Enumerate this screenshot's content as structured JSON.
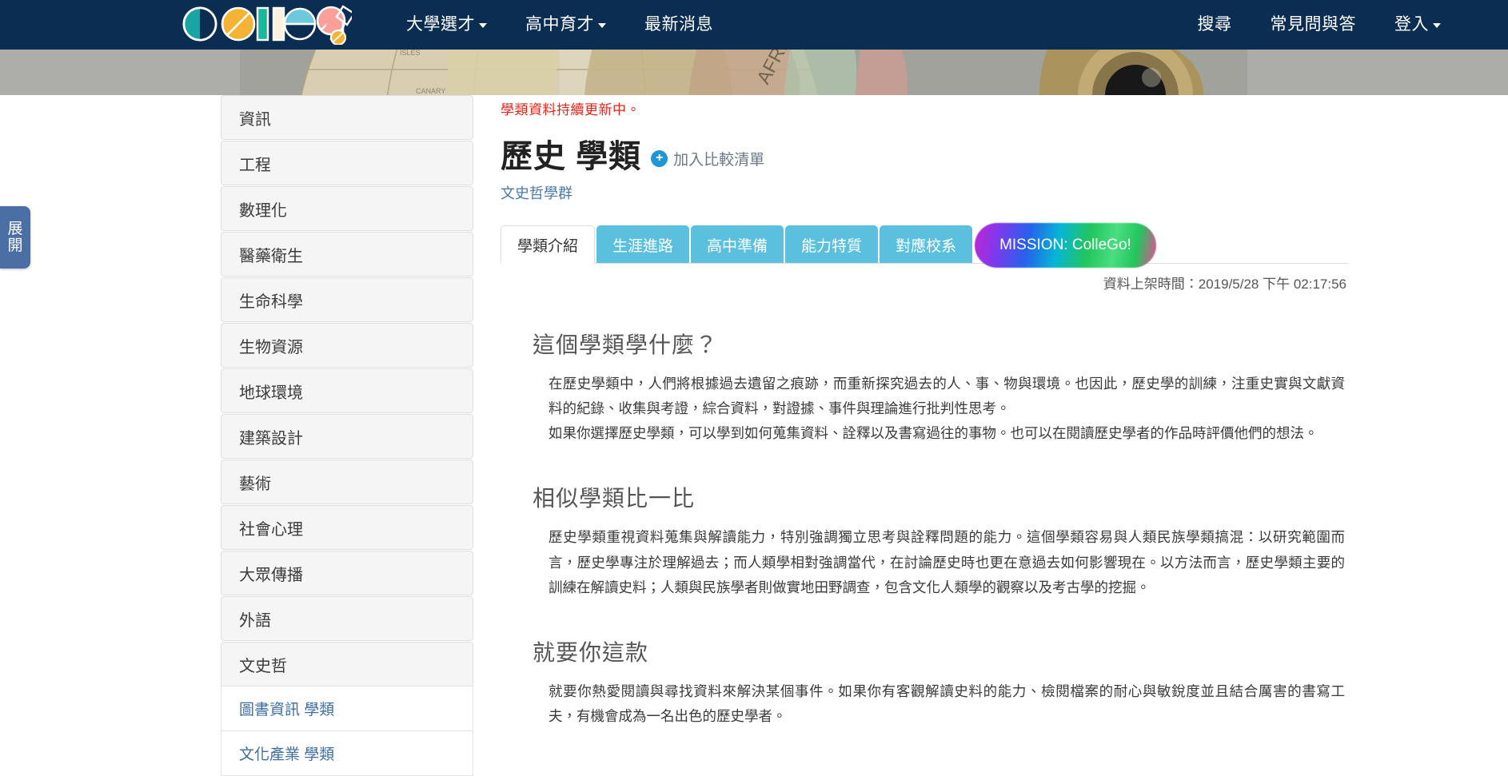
{
  "navbar": {
    "brand_text": "collego",
    "left_items": [
      {
        "label": "大學選才",
        "has_caret": true
      },
      {
        "label": "高中育才",
        "has_caret": true
      },
      {
        "label": "最新消息",
        "has_caret": false
      }
    ],
    "right_items": [
      {
        "label": "搜尋",
        "has_caret": false
      },
      {
        "label": "常見問與答",
        "has_caret": false
      },
      {
        "label": "登入",
        "has_caret": true
      }
    ],
    "background_color": "#0b2d52"
  },
  "expand_tab": {
    "label_line1": "展",
    "label_line2": "開",
    "color": "#4a6fa5"
  },
  "sidebar": {
    "items": [
      {
        "label": "資訊",
        "expanded": false
      },
      {
        "label": "工程",
        "expanded": false
      },
      {
        "label": "數理化",
        "expanded": false
      },
      {
        "label": "醫藥衛生",
        "expanded": false
      },
      {
        "label": "生命科學",
        "expanded": false
      },
      {
        "label": "生物資源",
        "expanded": false
      },
      {
        "label": "地球環境",
        "expanded": false
      },
      {
        "label": "建築設計",
        "expanded": false
      },
      {
        "label": "藝術",
        "expanded": false
      },
      {
        "label": "社會心理",
        "expanded": false
      },
      {
        "label": "大眾傳播",
        "expanded": false
      },
      {
        "label": "外語",
        "expanded": false
      },
      {
        "label": "文史哲",
        "expanded": true
      }
    ],
    "sub_items": [
      {
        "label": "圖書資訊 學類"
      },
      {
        "label": "文化產業 學類"
      }
    ]
  },
  "main": {
    "update_note": "學類資料持續更新中。",
    "title": "歷史 學類",
    "add_to_compare": "加入比較清單",
    "subtitle": "文史哲學群",
    "tabs": [
      {
        "label": "學類介紹",
        "active": true,
        "mission": false
      },
      {
        "label": "生涯進路",
        "active": false,
        "mission": false
      },
      {
        "label": "高中準備",
        "active": false,
        "mission": false
      },
      {
        "label": "能力特質",
        "active": false,
        "mission": false
      },
      {
        "label": "對應校系",
        "active": false,
        "mission": false
      },
      {
        "label": "MISSION: ColleGo!",
        "active": false,
        "mission": true
      }
    ],
    "publish_stamp": "資料上架時間：2019/5/28 下午 02:17:56",
    "sections": [
      {
        "heading": "這個學類學什麼？",
        "paragraphs": [
          "在歷史學類中，人們將根據過去遺留之痕跡，而重新探究過去的人、事、物與環境。也因此，歷史學的訓練，注重史實與文獻資料的紀錄、收集與考證，綜合資料，對證據、事件與理論進行批判性思考。",
          "如果你選擇歷史學類，可以學到如何蒐集資料、詮釋以及書寫過往的事物。也可以在閱讀歷史學者的作品時評價他們的想法。"
        ]
      },
      {
        "heading": "相似學類比一比",
        "paragraphs": [
          "歷史學類重視資料蒐集與解讀能力，特別強調獨立思考與詮釋問題的能力。這個學類容易與人類民族學類搞混：以研究範圍而言，歷史學專注於理解過去；而人類學相對強調當代，在討論歷史時也更在意過去如何影響現在。以方法而言，歷史學類主要的訓練在解讀史料；人類與民族學者則做實地田野調查，包含文化人類學的觀察以及考古學的挖掘。"
        ]
      },
      {
        "heading": "就要你這款",
        "paragraphs": [
          "就要你熱愛閱讀與尋找資料來解決某個事件。如果你有客觀解讀史料的能力、檢閱檔案的耐心與敏銳度並且結合厲害的書寫工夫，有機會成為一名出色的歷史學者。"
        ]
      }
    ]
  },
  "colors": {
    "navy": "#0b2d52",
    "tab_blue": "#5bc0de",
    "link_blue": "#3f6e9e",
    "alert_red": "#e2231a"
  }
}
